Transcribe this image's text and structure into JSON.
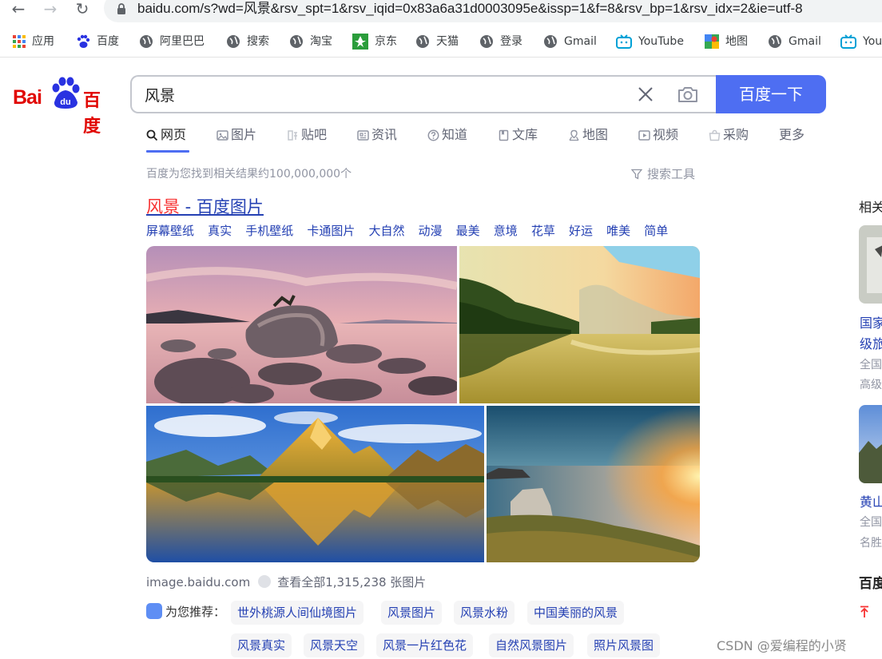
{
  "browser": {
    "url": "baidu.com/s?wd=风景&rsv_spt=1&rsv_iqid=0x83a6a31d0003095e&issp=1&f=8&rsv_bp=1&rsv_idx=2&ie=utf-8",
    "bookmarks": [
      "应用",
      "百度",
      "阿里巴巴",
      "搜索",
      "淘宝",
      "京东",
      "天猫",
      "登录",
      "Gmail",
      "YouTube",
      "地图",
      "Gmail",
      "You"
    ]
  },
  "logo": {
    "bai": "Bai",
    "du": "du",
    "baidu_cn": "百度"
  },
  "search": {
    "query": "风景",
    "button": "百度一下"
  },
  "tabs": [
    "网页",
    "图片",
    "贴吧",
    "资讯",
    "知道",
    "文库",
    "地图",
    "视频",
    "采购",
    "更多"
  ],
  "result_count": "百度为您找到相关结果约100,000,000个",
  "search_tools": "搜索工具",
  "image_result": {
    "title_highlight": "风景",
    "title_rest": " - 百度图片",
    "tags": [
      "屏幕壁纸",
      "真实",
      "手机壁纸",
      "卡通图片",
      "大自然",
      "动漫",
      "最美",
      "意境",
      "花草",
      "好运",
      "唯美",
      "简单"
    ],
    "source": "image.baidu.com",
    "view_all": "查看全部1,315,238 张图片"
  },
  "recommend": {
    "label": "为您推荐：",
    "items": [
      "世外桃源人间仙境图片",
      "风景图片",
      "风景水粉",
      "中国美丽的风景",
      "风景真实",
      "风景天空",
      "风景一片红色花",
      "自然风景图片",
      "照片风景图"
    ]
  },
  "right_column": {
    "heading": "相关",
    "item1_line1": "国家",
    "item1_line2": "级旅",
    "item1_sub1": "全国",
    "item1_sub2": "高级",
    "item2_line1": "黄山",
    "item2_sub1": "全国",
    "item2_sub2": "名胜",
    "section": "百度"
  },
  "watermark": "CSDN @爱编程的小贤",
  "colors": {
    "accent": "#4e6ef2",
    "link": "#2440b3",
    "highlight": "#f73131",
    "logo": "#e10602"
  }
}
